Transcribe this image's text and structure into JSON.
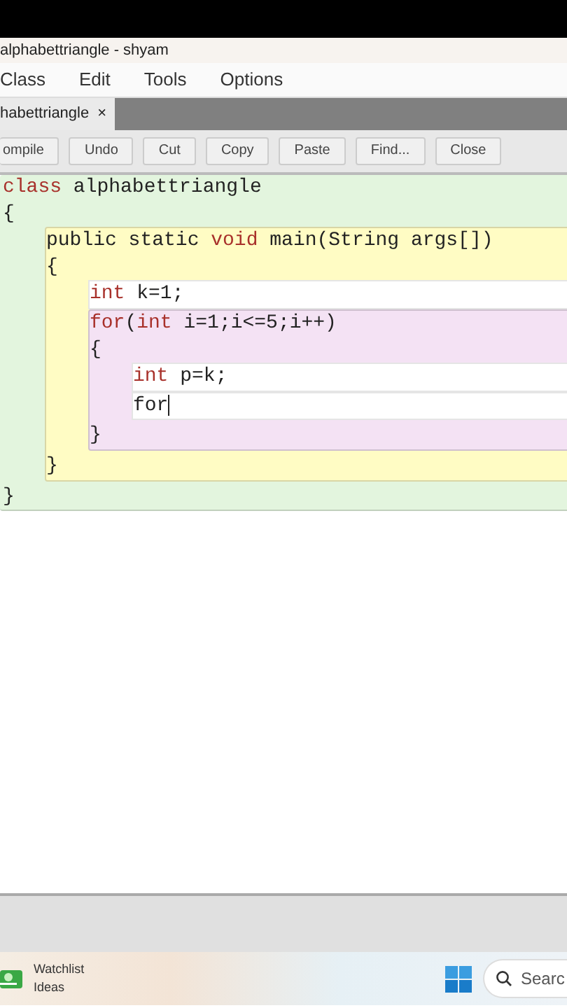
{
  "window": {
    "title": "alphabettriangle - shyam"
  },
  "menu": [
    "Class",
    "Edit",
    "Tools",
    "Options"
  ],
  "tabs": [
    {
      "label": "habettriangle",
      "selected": true,
      "close": "×"
    }
  ],
  "toolbar": [
    "ompile",
    "Undo",
    "Cut",
    "Copy",
    "Paste",
    "Find...",
    "Close"
  ],
  "editor": {
    "scope": {
      "kind": "scope",
      "header": [
        {
          "text": "class",
          "kind": "keyword"
        },
        {
          "text": " alphabettriangle",
          "kind": "plain"
        }
      ],
      "open": "{",
      "close": "}",
      "children": [
        {
          "kind": "scope",
          "header": [
            {
              "text": "public static ",
              "kind": "plain"
            },
            {
              "text": "void",
              "kind": "keyword"
            },
            {
              "text": " main(String args[])",
              "kind": "plain"
            }
          ],
          "open": "{",
          "close": "}",
          "children": [
            {
              "kind": "line",
              "tokens": [
                {
                  "text": "int",
                  "kind": "keyword"
                },
                {
                  "text": " k=1;",
                  "kind": "plain"
                }
              ]
            },
            {
              "kind": "scope",
              "header": [
                {
                  "text": "for",
                  "kind": "keyword"
                },
                {
                  "text": "(",
                  "kind": "plain"
                },
                {
                  "text": "int",
                  "kind": "keyword"
                },
                {
                  "text": " i=1;i<=5;i++)",
                  "kind": "plain"
                }
              ],
              "open": "{",
              "close": "}",
              "children": [
                {
                  "kind": "line",
                  "tokens": [
                    {
                      "text": "int",
                      "kind": "keyword"
                    },
                    {
                      "text": " p=k;",
                      "kind": "plain"
                    }
                  ]
                },
                {
                  "kind": "line",
                  "cursor": true,
                  "tokens": [
                    {
                      "text": "for",
                      "kind": "plain"
                    }
                  ]
                }
              ]
            }
          ]
        }
      ]
    }
  },
  "taskbar": {
    "widget_title": "Watchlist",
    "widget_subtitle": "Ideas",
    "search": "Searc"
  }
}
